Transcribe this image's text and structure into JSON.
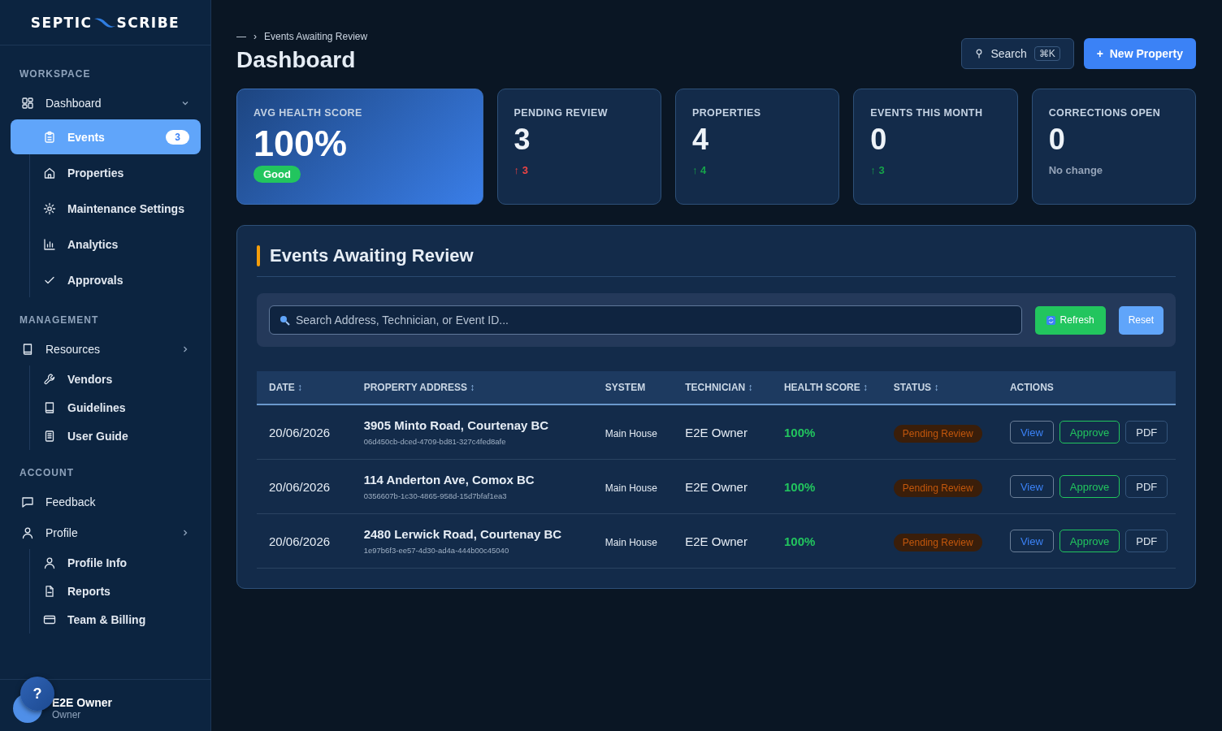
{
  "logo": {
    "left": "SEPTIC",
    "right": "SCRIBE"
  },
  "sidebar": {
    "sections": [
      {
        "heading": "WORKSPACE",
        "items": [
          {
            "label": "Dashboard",
            "selected": false,
            "expanded": true,
            "children": [
              {
                "label": "Events",
                "selected": true,
                "badge": "3"
              },
              {
                "label": "Properties",
                "selected": false
              },
              {
                "label": "Maintenance Settings",
                "selected": false
              },
              {
                "label": "Analytics",
                "selected": false
              },
              {
                "label": "Approvals",
                "selected": false
              }
            ]
          }
        ]
      },
      {
        "heading": "MANAGEMENT",
        "items": [
          {
            "label": "Resources",
            "selected": false,
            "expanded": false,
            "children": [
              {
                "label": "Vendors",
                "selected": false
              },
              {
                "label": "Guidelines",
                "selected": false
              },
              {
                "label": "User Guide",
                "selected": false
              }
            ]
          }
        ]
      },
      {
        "heading": "ACCOUNT",
        "items": [
          {
            "label": "Feedback",
            "selected": false
          },
          {
            "label": "Profile",
            "selected": false,
            "expanded": false,
            "children": [
              {
                "label": "Profile Info",
                "selected": false
              },
              {
                "label": "Reports",
                "selected": false
              },
              {
                "label": "Team & Billing",
                "selected": false
              }
            ]
          }
        ]
      }
    ]
  },
  "user": {
    "name": "E2E Owner",
    "role": "Owner",
    "help": "?"
  },
  "breadcrumb": {
    "items": [
      "—",
      "Events Awaiting Review"
    ],
    "separator": "›"
  },
  "title": "Dashboard",
  "header_buttons": {
    "search": {
      "label": "Search",
      "shortcut": "⌘K"
    },
    "new_property": {
      "icon": "+",
      "label": "New Property"
    }
  },
  "stats": [
    {
      "kind": "featured",
      "label": "AVG HEALTH SCORE",
      "value": "100%",
      "badge": "Good"
    },
    {
      "kind": "plain",
      "label": "PENDING REVIEW",
      "value": "3",
      "delta": "↑ 3",
      "color": "#ef4444"
    },
    {
      "kind": "plain",
      "label": "PROPERTIES",
      "value": "4",
      "delta": "↑ 4",
      "color": "#16a34a"
    },
    {
      "kind": "plain",
      "label": "EVENTS THIS MONTH",
      "value": "0",
      "delta": "↑ 3",
      "color": "#16a34a"
    },
    {
      "kind": "plain",
      "label": "CORRECTIONS OPEN",
      "value": "0",
      "delta": "No change",
      "color": "#94a3b8"
    }
  ],
  "panel": {
    "title": "Events Awaiting Review",
    "search": {
      "placeholder": "Search Address, Technician, or Event ID..."
    },
    "refresh": "Refresh",
    "reset": "Reset",
    "table": {
      "columns": [
        {
          "label": "DATE",
          "sortable": true
        },
        {
          "label": "PROPERTY ADDRESS",
          "sortable": true
        },
        {
          "label": "SYSTEM",
          "sortable": false
        },
        {
          "label": "TECHNICIAN",
          "sortable": true
        },
        {
          "label": "HEALTH SCORE",
          "sortable": true
        },
        {
          "label": "STATUS",
          "sortable": true
        },
        {
          "label": "ACTIONS",
          "sortable": false
        }
      ],
      "sort_glyph": "↕",
      "rows": [
        {
          "date": "20/06/2026",
          "address": "3905 Minto Road, Courtenay BC",
          "event_id": "06d450cb-dced-4709-bd81-327c4fed8afe",
          "system": "Main House",
          "technician": "E2E Owner",
          "health": "100%",
          "status": "Pending Review",
          "actions": [
            {
              "kind": "view",
              "label": "View"
            },
            {
              "kind": "approve",
              "label": "Approve"
            },
            {
              "kind": "pdf",
              "label": "PDF"
            }
          ]
        },
        {
          "date": "20/06/2026",
          "address": "114 Anderton Ave, Comox BC",
          "event_id": "0356607b-1c30-4865-958d-15d7bfaf1ea3",
          "system": "Main House",
          "technician": "E2E Owner",
          "health": "100%",
          "status": "Pending Review",
          "actions": [
            {
              "kind": "view",
              "label": "View"
            },
            {
              "kind": "approve",
              "label": "Approve"
            },
            {
              "kind": "pdf",
              "label": "PDF"
            }
          ]
        },
        {
          "date": "20/06/2026",
          "address": "2480 Lerwick Road, Courtenay BC",
          "event_id": "1e97b6f3-ee57-4d30-ad4a-444b00c45040",
          "system": "Main House",
          "technician": "E2E Owner",
          "health": "100%",
          "status": "Pending Review",
          "actions": [
            {
              "kind": "view",
              "label": "View"
            },
            {
              "kind": "approve",
              "label": "Approve"
            },
            {
              "kind": "pdf",
              "label": "PDF"
            }
          ]
        }
      ]
    }
  }
}
